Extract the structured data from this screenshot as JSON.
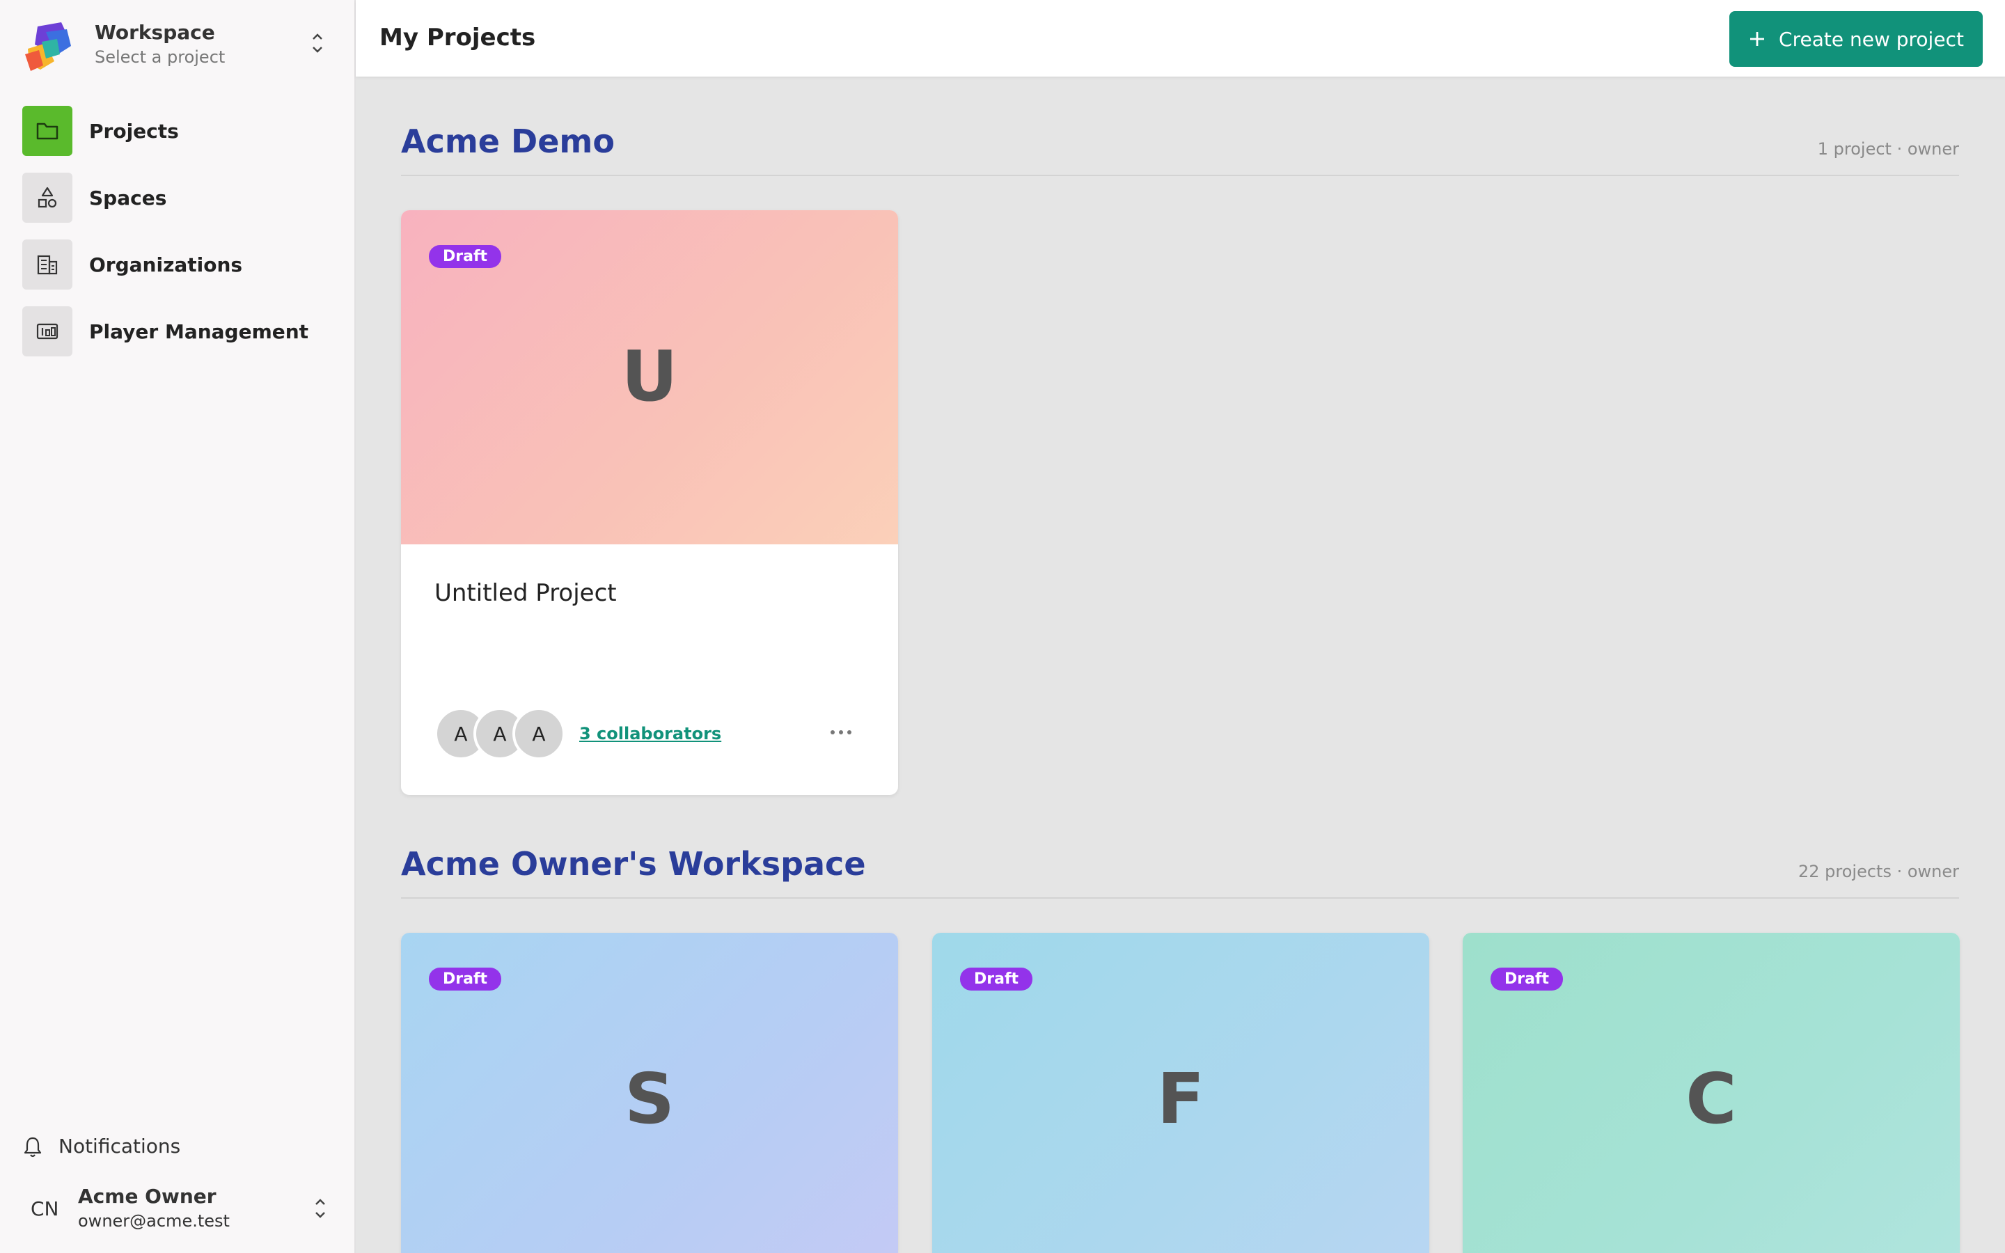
{
  "workspace": {
    "name": "Workspace",
    "subtitle": "Select a project"
  },
  "nav": [
    {
      "label": "Projects",
      "icon": "folder-icon",
      "active": true
    },
    {
      "label": "Spaces",
      "icon": "shapes-icon",
      "active": false
    },
    {
      "label": "Organizations",
      "icon": "building-icon",
      "active": false
    },
    {
      "label": "Player Management",
      "icon": "player-management-icon",
      "active": false
    }
  ],
  "notifications": {
    "label": "Notifications"
  },
  "user": {
    "initials": "CN",
    "name": "Acme Owner",
    "email": "owner@acme.test"
  },
  "header": {
    "title": "My Projects",
    "create_label": "Create new project"
  },
  "sections": [
    {
      "title": "Acme Demo",
      "meta": "1 project · owner",
      "cards": [
        {
          "status": "Draft",
          "initial": "U",
          "title": "Untitled Project",
          "collaborators": [
            "A",
            "A",
            "A"
          ],
          "collaborators_label": "3 collaborators"
        }
      ]
    },
    {
      "title": "Acme Owner's Workspace",
      "meta": "22 projects · owner",
      "cards": [
        {
          "status": "Draft",
          "initial": "S"
        },
        {
          "status": "Draft",
          "initial": "F"
        },
        {
          "status": "Draft",
          "initial": "C"
        }
      ]
    }
  ],
  "colors": {
    "primary": "#11927a",
    "nav_active": "#5aba2c",
    "badge": "#9333ea",
    "section_title": "#2a3d9a"
  }
}
